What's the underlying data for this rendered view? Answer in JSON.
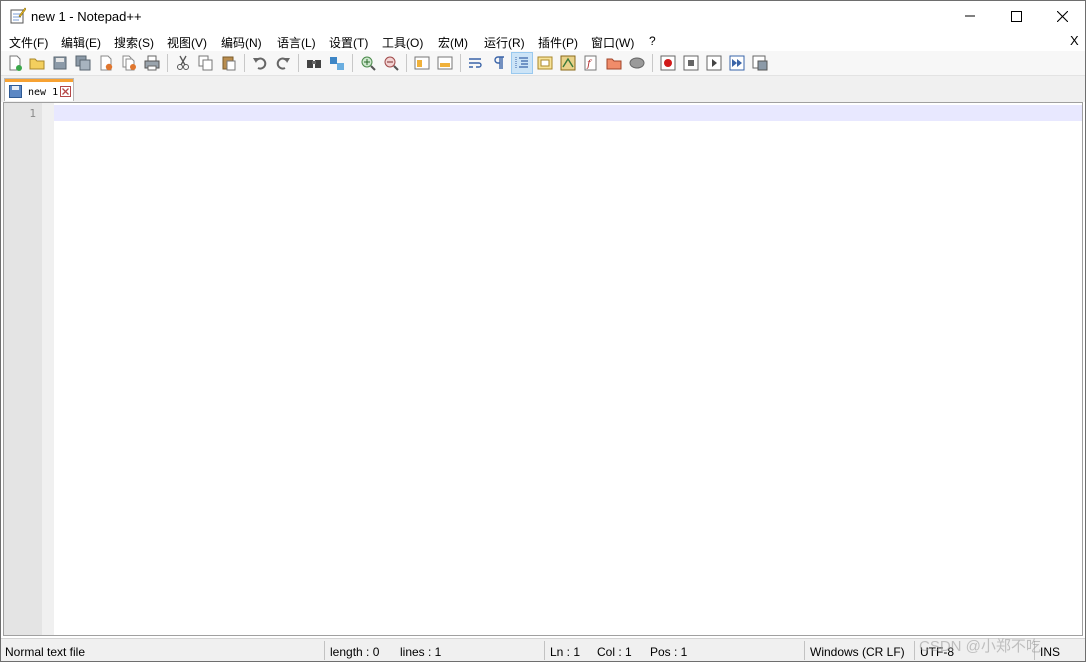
{
  "window": {
    "title": "new 1 - Notepad++"
  },
  "menu": {
    "items": [
      "文件(F)",
      "编辑(E)",
      "搜索(S)",
      "视图(V)",
      "编码(N)",
      "语言(L)",
      "设置(T)",
      "工具(O)",
      "宏(M)",
      "运行(R)",
      "插件(P)",
      "窗口(W)",
      "?"
    ],
    "close_label": "X"
  },
  "toolbar": {
    "icons": [
      "new-file-icon",
      "open-file-icon",
      "save-icon",
      "save-all-icon",
      "close-icon",
      "close-all-icon",
      "print-icon",
      "cut-icon",
      "copy-icon",
      "paste-icon",
      "undo-icon",
      "redo-icon",
      "find-icon",
      "replace-icon",
      "zoom-in-icon",
      "zoom-out-icon",
      "sync-vertical-icon",
      "sync-horizontal-icon",
      "word-wrap-icon",
      "show-all-chars-icon",
      "indent-guide-icon",
      "user-lang-icon",
      "doc-map-icon",
      "function-list-icon",
      "folder-workspace-icon",
      "monitor-icon",
      "record-macro-icon",
      "stop-record-icon",
      "play-macro-icon",
      "run-macro-multiple-icon",
      "save-macro-icon"
    ],
    "active_icon": "indent-guide-icon"
  },
  "tabs": [
    {
      "label": "new 1"
    }
  ],
  "editor": {
    "line_numbers": [
      "1"
    ]
  },
  "status": {
    "file_type": "Normal text file",
    "length": "length : 0",
    "lines": "lines : 1",
    "ln": "Ln : 1",
    "col": "Col : 1",
    "pos": "Pos : 1",
    "eol": "Windows (CR LF)",
    "encoding": "UTF-8",
    "mode": "INS"
  },
  "watermark": "CSDN @小郑不吃",
  "colors": {
    "tab_accent": "#f7a232",
    "current_line": "#e8e8ff",
    "active_tool": "#cce4f7"
  }
}
